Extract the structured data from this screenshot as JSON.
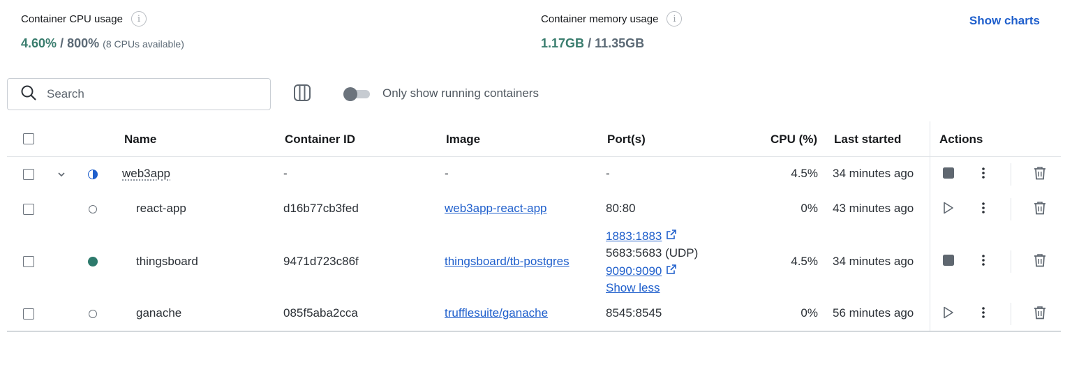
{
  "stats": {
    "cpu": {
      "label": "Container CPU usage",
      "used": "4.60%",
      "separator": "/",
      "total": "800%",
      "note": "(8 CPUs available)"
    },
    "memory": {
      "label": "Container memory usage",
      "used": "1.17GB",
      "separator": "/",
      "total": "11.35GB"
    },
    "show_charts_label": "Show charts"
  },
  "toolbar": {
    "search_placeholder": "Search",
    "toggle_label": "Only show running containers",
    "toggle_on": false
  },
  "table": {
    "headers": {
      "name": "Name",
      "container_id": "Container ID",
      "image": "Image",
      "ports": "Port(s)",
      "cpu": "CPU (%)",
      "last_started": "Last started",
      "actions": "Actions"
    },
    "group": {
      "name": "web3app",
      "container_id": "-",
      "image": "-",
      "ports": "-",
      "cpu": "4.5%",
      "last_started": "34 minutes ago",
      "status": "partial"
    },
    "rows": [
      {
        "name": "react-app",
        "container_id": "d16b77cb3fed",
        "image": "web3app-react-app",
        "ports": [
          "80:80"
        ],
        "cpu": "0%",
        "last_started": "43 minutes ago",
        "status": "stopped"
      },
      {
        "name": "thingsboard",
        "container_id": "9471d723c86f",
        "image": "thingsboard/tb-postgres",
        "ports": [
          "1883:1883",
          "5683:5683 (UDP)",
          "9090:9090"
        ],
        "show_less": "Show less",
        "cpu": "4.5%",
        "last_started": "34 minutes ago",
        "status": "running"
      },
      {
        "name": "ganache",
        "container_id": "085f5aba2cca",
        "image": "trufflesuite/ganache",
        "ports": [
          "8545:8545"
        ],
        "cpu": "0%",
        "last_started": "56 minutes ago",
        "status": "stopped"
      }
    ]
  },
  "colors": {
    "accent": "#1f5fcc",
    "running": "#2d7a6c",
    "stat_value": "#3a7d6e",
    "icon": "#5f6770"
  }
}
